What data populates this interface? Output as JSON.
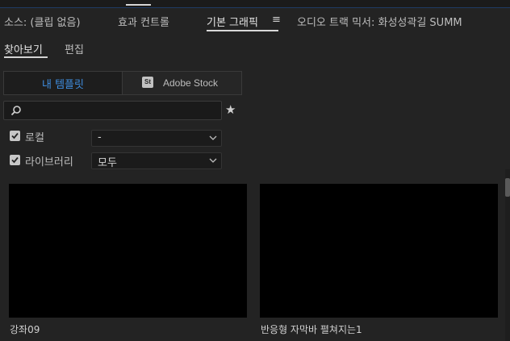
{
  "panel_tabs": [
    {
      "label": "소스: (클립 없음)",
      "active": false
    },
    {
      "label": "효과 컨트롤",
      "active": false
    },
    {
      "label": "기본 그래픽",
      "active": true
    },
    {
      "label": "오디오 트랙 믹서: 화성성곽길 SUMM",
      "active": false
    }
  ],
  "panel_menu_icon": "≡",
  "sub_tabs": [
    {
      "label": "찾아보기",
      "active": true
    },
    {
      "label": "편집",
      "active": false
    }
  ],
  "source_toggle": {
    "my_templates_label": "내 템플릿",
    "stock_badge": "St",
    "stock_label": "Adobe Stock"
  },
  "search": {
    "value": "",
    "placeholder": ""
  },
  "filters": {
    "local": {
      "label": "로컬",
      "checked": true,
      "dropdown_value": "-"
    },
    "libraries": {
      "label": "라이브러리",
      "checked": true,
      "dropdown_value": "모두"
    }
  },
  "templates": [
    {
      "name": "강좌09"
    },
    {
      "name": "반응형 자막바 펼쳐지는1"
    }
  ],
  "colors": {
    "accent_blue": "#3f8ee0",
    "background": "#232323",
    "thumbnail": "#000000"
  }
}
